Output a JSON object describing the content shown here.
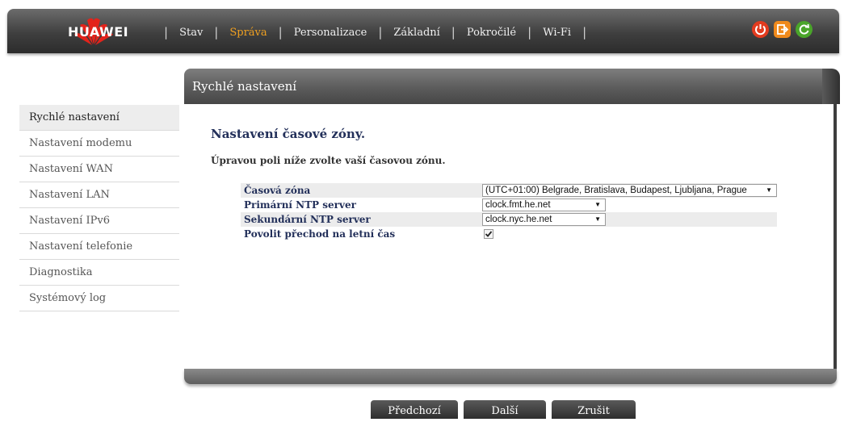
{
  "brand": "HUAWEI",
  "nav": [
    "Stav",
    "Správa",
    "Personalizace",
    "Základní",
    "Pokročilé",
    "Wi-Fi"
  ],
  "nav_active": "Správa",
  "colors": {
    "accent": "#f0a020",
    "power": "#e23b1f",
    "logout": "#f08a1c",
    "refresh": "#4aa52a",
    "heading": "#23305a"
  },
  "icons": [
    "power-icon",
    "logout-icon",
    "refresh-icon"
  ],
  "sidebar": {
    "items": [
      {
        "label": "Rychlé nastavení",
        "active": true
      },
      {
        "label": "Nastavení modemu"
      },
      {
        "label": "Nastavení WAN"
      },
      {
        "label": "Nastavení LAN"
      },
      {
        "label": "Nastavení IPv6"
      },
      {
        "label": "Nastavení telefonie"
      },
      {
        "label": "Diagnostika"
      },
      {
        "label": "Systémový log"
      }
    ]
  },
  "panel": {
    "title": "Rychlé nastavení",
    "section_title": "Nastavení časové zóny.",
    "description": "Úpravou poli níže zvolte vaší časovou zónu."
  },
  "form": {
    "timezone": {
      "label": "Časová zóna",
      "value": "(UTC+01:00) Belgrade, Bratislava, Budapest, Ljubljana, Prague"
    },
    "ntp_primary": {
      "label": "Primární NTP server",
      "value": "clock.fmt.he.net"
    },
    "ntp_secondary": {
      "label": "Sekundární NTP server",
      "value": "clock.nyc.he.net"
    },
    "dst": {
      "label": "Povolit přechod na letní čas",
      "checked": true
    }
  },
  "buttons": {
    "prev": "Předchozí",
    "next": "Další",
    "cancel": "Zrušit"
  }
}
